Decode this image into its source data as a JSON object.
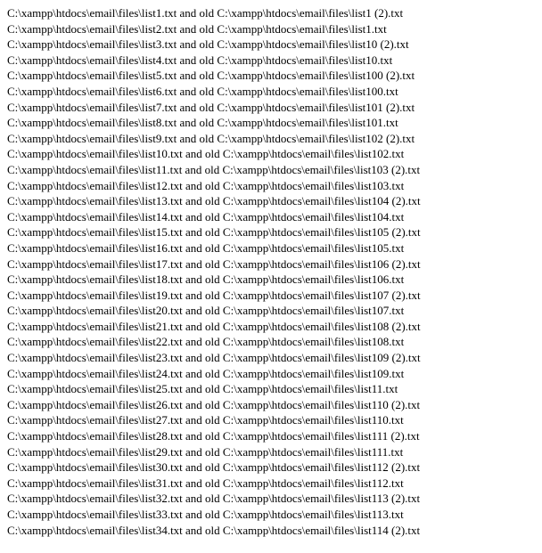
{
  "page": {
    "background_color": "#ffffff",
    "text_color": "#000000",
    "title": "File rename comparison output"
  },
  "output": {
    "line_count": 34,
    "lines": [
      "C:\\xampp\\htdocs\\email\\files\\list1.txt and old C:\\xampp\\htdocs\\email\\files\\list1 (2).txt",
      "C:\\xampp\\htdocs\\email\\files\\list2.txt and old C:\\xampp\\htdocs\\email\\files\\list1.txt",
      "C:\\xampp\\htdocs\\email\\files\\list3.txt and old C:\\xampp\\htdocs\\email\\files\\list10 (2).txt",
      "C:\\xampp\\htdocs\\email\\files\\list4.txt and old C:\\xampp\\htdocs\\email\\files\\list10.txt",
      "C:\\xampp\\htdocs\\email\\files\\list5.txt and old C:\\xampp\\htdocs\\email\\files\\list100 (2).txt",
      "C:\\xampp\\htdocs\\email\\files\\list6.txt and old C:\\xampp\\htdocs\\email\\files\\list100.txt",
      "C:\\xampp\\htdocs\\email\\files\\list7.txt and old C:\\xampp\\htdocs\\email\\files\\list101 (2).txt",
      "C:\\xampp\\htdocs\\email\\files\\list8.txt and old C:\\xampp\\htdocs\\email\\files\\list101.txt",
      "C:\\xampp\\htdocs\\email\\files\\list9.txt and old C:\\xampp\\htdocs\\email\\files\\list102 (2).txt",
      "C:\\xampp\\htdocs\\email\\files\\list10.txt and old C:\\xampp\\htdocs\\email\\files\\list102.txt",
      "C:\\xampp\\htdocs\\email\\files\\list11.txt and old C:\\xampp\\htdocs\\email\\files\\list103 (2).txt",
      "C:\\xampp\\htdocs\\email\\files\\list12.txt and old C:\\xampp\\htdocs\\email\\files\\list103.txt",
      "C:\\xampp\\htdocs\\email\\files\\list13.txt and old C:\\xampp\\htdocs\\email\\files\\list104 (2).txt",
      "C:\\xampp\\htdocs\\email\\files\\list14.txt and old C:\\xampp\\htdocs\\email\\files\\list104.txt",
      "C:\\xampp\\htdocs\\email\\files\\list15.txt and old C:\\xampp\\htdocs\\email\\files\\list105 (2).txt",
      "C:\\xampp\\htdocs\\email\\files\\list16.txt and old C:\\xampp\\htdocs\\email\\files\\list105.txt",
      "C:\\xampp\\htdocs\\email\\files\\list17.txt and old C:\\xampp\\htdocs\\email\\files\\list106 (2).txt",
      "C:\\xampp\\htdocs\\email\\files\\list18.txt and old C:\\xampp\\htdocs\\email\\files\\list106.txt",
      "C:\\xampp\\htdocs\\email\\files\\list19.txt and old C:\\xampp\\htdocs\\email\\files\\list107 (2).txt",
      "C:\\xampp\\htdocs\\email\\files\\list20.txt and old C:\\xampp\\htdocs\\email\\files\\list107.txt",
      "C:\\xampp\\htdocs\\email\\files\\list21.txt and old C:\\xampp\\htdocs\\email\\files\\list108 (2).txt",
      "C:\\xampp\\htdocs\\email\\files\\list22.txt and old C:\\xampp\\htdocs\\email\\files\\list108.txt",
      "C:\\xampp\\htdocs\\email\\files\\list23.txt and old C:\\xampp\\htdocs\\email\\files\\list109 (2).txt",
      "C:\\xampp\\htdocs\\email\\files\\list24.txt and old C:\\xampp\\htdocs\\email\\files\\list109.txt",
      "C:\\xampp\\htdocs\\email\\files\\list25.txt and old C:\\xampp\\htdocs\\email\\files\\list11.txt",
      "C:\\xampp\\htdocs\\email\\files\\list26.txt and old C:\\xampp\\htdocs\\email\\files\\list110 (2).txt",
      "C:\\xampp\\htdocs\\email\\files\\list27.txt and old C:\\xampp\\htdocs\\email\\files\\list110.txt",
      "C:\\xampp\\htdocs\\email\\files\\list28.txt and old C:\\xampp\\htdocs\\email\\files\\list111 (2).txt",
      "C:\\xampp\\htdocs\\email\\files\\list29.txt and old C:\\xampp\\htdocs\\email\\files\\list111.txt",
      "C:\\xampp\\htdocs\\email\\files\\list30.txt and old C:\\xampp\\htdocs\\email\\files\\list112 (2).txt",
      "C:\\xampp\\htdocs\\email\\files\\list31.txt and old C:\\xampp\\htdocs\\email\\files\\list112.txt",
      "C:\\xampp\\htdocs\\email\\files\\list32.txt and old C:\\xampp\\htdocs\\email\\files\\list113 (2).txt",
      "C:\\xampp\\htdocs\\email\\files\\list33.txt and old C:\\xampp\\htdocs\\email\\files\\list113.txt",
      "C:\\xampp\\htdocs\\email\\files\\list34.txt and old C:\\xampp\\htdocs\\email\\files\\list114 (2).txt"
    ]
  }
}
